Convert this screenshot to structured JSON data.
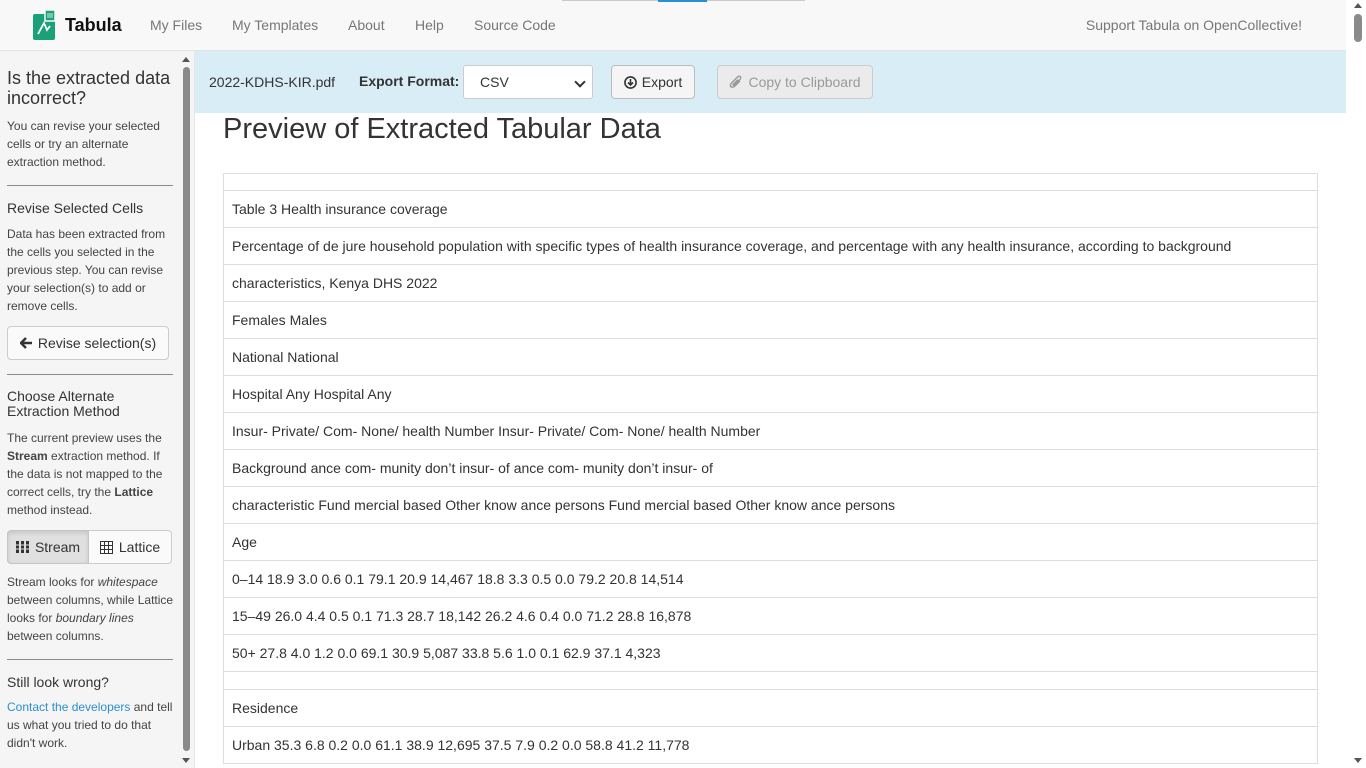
{
  "navbar": {
    "brand": "Tabula",
    "links": [
      "My Files",
      "My Templates",
      "About",
      "Help",
      "Source Code"
    ],
    "support": "Support Tabula on OpenCollective!"
  },
  "sidebar": {
    "heading": "Is the extracted data incorrect?",
    "intro": "You can revise your selected cells or try an alternate extraction method.",
    "revise_heading": "Revise Selected Cells",
    "revise_text": "Data has been extracted from the cells you selected in the previous step. You can revise your selection(s) to add or remove cells.",
    "revise_button": "Revise selection(s)",
    "method_heading": "Choose Alternate Extraction Method",
    "method_text_1": "The current preview uses the ",
    "method_current": "Stream",
    "method_text_2": " extraction method. If the data is not mapped to the correct cells, try the ",
    "method_alt": "Lattice",
    "method_text_3": " method instead.",
    "stream_button": "Stream",
    "lattice_button": "Lattice",
    "help_text_1": "Stream looks for ",
    "help_em_1": "whitespace",
    "help_text_2": " between columns, while Lattice looks for ",
    "help_em_2": "boundary lines",
    "help_text_3": " between columns.",
    "wrong_heading": "Still look wrong?",
    "contact_link": "Contact the developers",
    "contact_text": " and tell us what you tried to do that didn't work."
  },
  "export_bar": {
    "filename": "2022-KDHS-KIR.pdf",
    "format_label": "Export Format:",
    "format_value": "CSV",
    "export_button": "Export",
    "copy_button": "Copy to Clipboard"
  },
  "main": {
    "title": "Preview of Extracted Tabular Data",
    "rows": [
      "",
      "Table 3 Health insurance coverage",
      "Percentage of de jure household population with specific types of health insurance coverage, and percentage with any health insurance, according to background",
      "characteristics, Kenya DHS 2022",
      "Females Males",
      "National National",
      "Hospital Any Hospital Any",
      "Insur- Private/ Com- None/ health Number Insur- Private/ Com- None/ health Number",
      "Background ance com- munity don’t insur- of ance com- munity don’t insur- of",
      "characteristic Fund mercial based Other know ance persons Fund mercial based Other know ance persons",
      "Age",
      "0–14 18.9 3.0 0.6 0.1 79.1 20.9 14,467 18.8 3.3 0.5 0.0 79.2 20.8 14,514",
      "15–49 26.0 4.4 0.5 0.1 71.3 28.7 18,142 26.2 4.6 0.4 0.0 71.2 28.8 16,878",
      "50+ 27.8 4.0 1.2 0.0 69.1 30.9 5,087 33.8 5.6 1.0 0.1 62.9 37.1 4,323",
      "",
      "Residence",
      "Urban 35.3 6.8 0.2 0.0 61.1 38.9 12,695 37.5 7.9 0.2 0.0 58.8 41.2 11,778"
    ]
  }
}
